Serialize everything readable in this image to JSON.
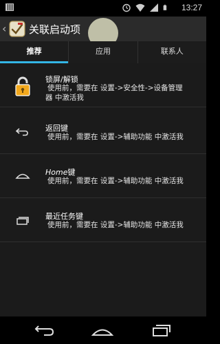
{
  "status_bar": {
    "time": "13:27",
    "icons": [
      "alarm-icon",
      "wifi-icon",
      "signal-icon",
      "battery-icon"
    ]
  },
  "action_bar": {
    "title": "关联启动项"
  },
  "tabs": [
    {
      "label": "推荐",
      "active": true
    },
    {
      "label": "应用",
      "active": false
    },
    {
      "label": "联系人",
      "active": false
    }
  ],
  "items": [
    {
      "title": "锁屏/解锁",
      "desc_lines": [
        "使用前，需要在 设置->安全性->设备管理",
        "器 中激活我"
      ],
      "icon": "padlock-icon"
    },
    {
      "title": "返回键",
      "desc_lines": [
        "使用前，需要在 设置->辅助功能 中激活我"
      ],
      "icon": "back-arrow-icon"
    },
    {
      "title_italic": "Home",
      "title_rest": "键",
      "desc_lines": [
        "使用前，需要在 设置->辅助功能 中激活我"
      ],
      "icon": "home-icon"
    },
    {
      "title": "最近任务键",
      "desc_lines": [
        "使用前，需要在 设置->辅助功能 中激活我"
      ],
      "icon": "recent-apps-icon"
    }
  ],
  "nav_bar": {
    "buttons": [
      "back-icon",
      "home-icon",
      "recent-apps-icon"
    ]
  }
}
